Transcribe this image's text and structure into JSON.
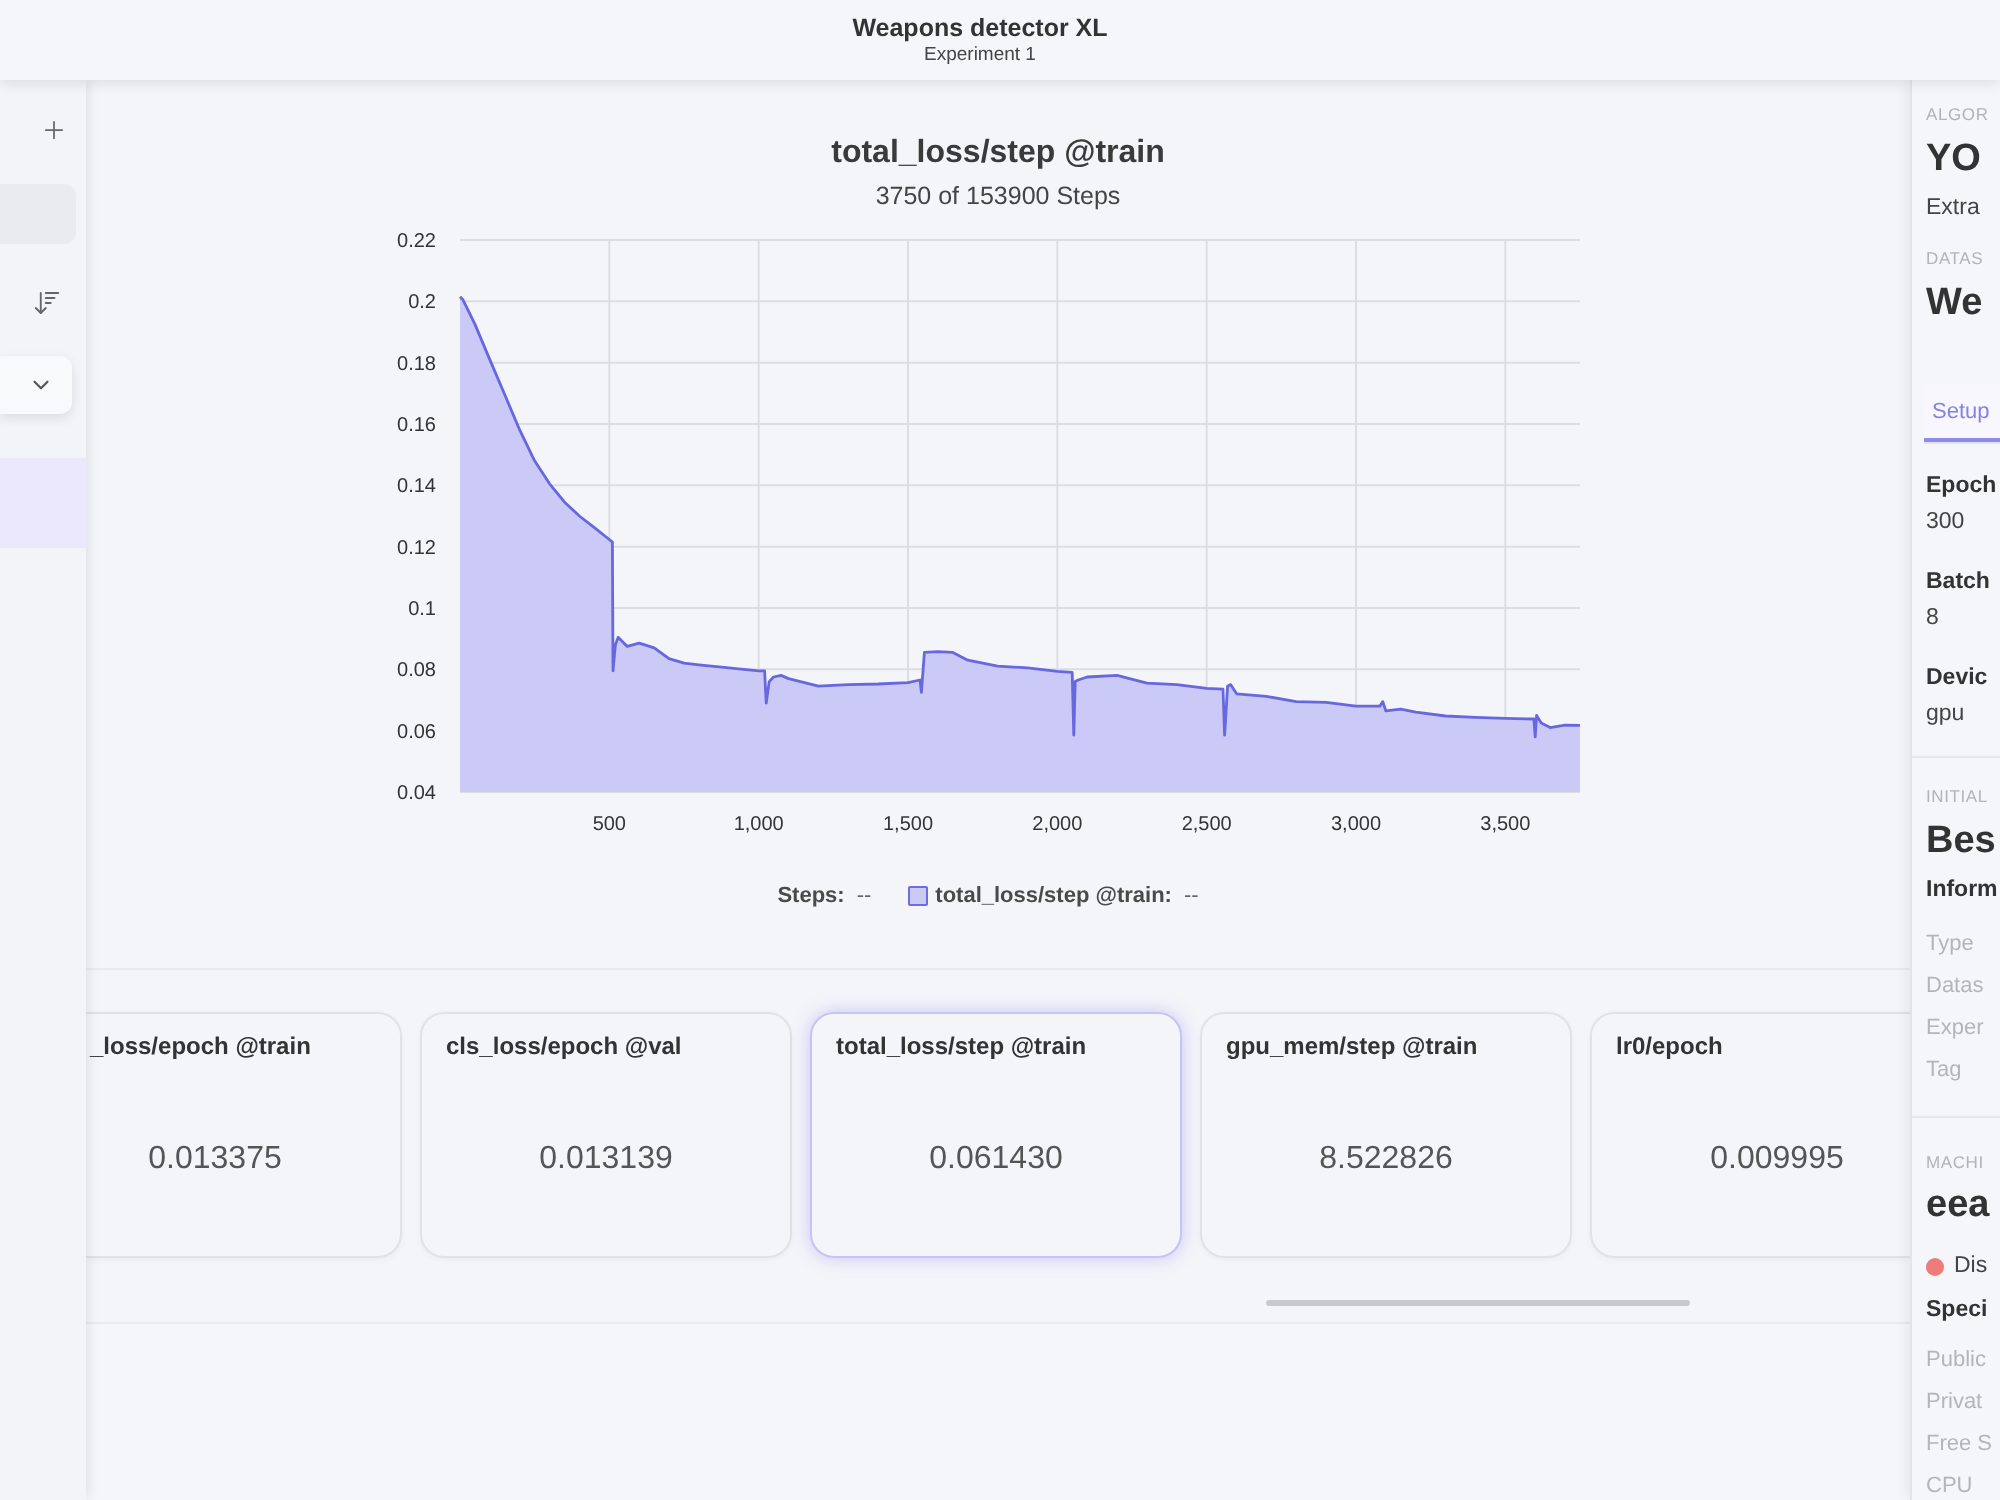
{
  "window": {
    "title": "Weapons detector XL",
    "subtitle": "Experiment 1"
  },
  "sidebar": {
    "items": [
      {
        "selected": true
      }
    ]
  },
  "chart": {
    "subtitle": "3750 of 153900 Steps",
    "chart_data": {
      "type": "area",
      "title": "total_loss/step @train",
      "grid": true,
      "x": [
        0,
        10,
        50,
        100,
        150,
        200,
        250,
        300,
        350,
        400,
        450,
        510,
        512,
        520,
        530,
        560,
        600,
        650,
        700,
        750,
        800,
        900,
        1000,
        1020,
        1025,
        1035,
        1050,
        1075,
        1100,
        1200,
        1300,
        1400,
        1500,
        1540,
        1545,
        1555,
        1600,
        1650,
        1700,
        1800,
        1900,
        2000,
        2050,
        2055,
        2060,
        2070,
        2100,
        2200,
        2300,
        2400,
        2500,
        2555,
        2560,
        2570,
        2580,
        2600,
        2700,
        2800,
        2900,
        3000,
        3080,
        3090,
        3100,
        3150,
        3200,
        3300,
        3400,
        3500,
        3595,
        3600,
        3605,
        3620,
        3650,
        3700,
        3750
      ],
      "values": [
        0.2015,
        0.2005,
        0.1925,
        0.181,
        0.1695,
        0.158,
        0.148,
        0.1405,
        0.1345,
        0.13,
        0.1262,
        0.1215,
        0.0795,
        0.088,
        0.0905,
        0.0875,
        0.0885,
        0.087,
        0.0835,
        0.082,
        0.0815,
        0.0805,
        0.0795,
        0.0795,
        0.069,
        0.076,
        0.0775,
        0.078,
        0.077,
        0.0745,
        0.075,
        0.0752,
        0.0757,
        0.0765,
        0.0725,
        0.0855,
        0.0858,
        0.0855,
        0.083,
        0.081,
        0.0805,
        0.0793,
        0.079,
        0.0585,
        0.076,
        0.0765,
        0.0775,
        0.078,
        0.0755,
        0.075,
        0.0738,
        0.0735,
        0.0585,
        0.0745,
        0.075,
        0.072,
        0.0712,
        0.0695,
        0.0692,
        0.068,
        0.068,
        0.0695,
        0.0665,
        0.067,
        0.066,
        0.0648,
        0.0643,
        0.064,
        0.0638,
        0.058,
        0.065,
        0.0625,
        0.061,
        0.0618,
        0.0617
      ],
      "xlim": [
        0,
        3750
      ],
      "ylim": [
        0.04,
        0.22
      ],
      "xticks": [
        {
          "value": 500,
          "label": "500"
        },
        {
          "value": 1000,
          "label": "1,000"
        },
        {
          "value": 1500,
          "label": "1,500"
        },
        {
          "value": 2000,
          "label": "2,000"
        },
        {
          "value": 2500,
          "label": "2,500"
        },
        {
          "value": 3000,
          "label": "3,000"
        },
        {
          "value": 3500,
          "label": "3,500"
        }
      ],
      "yticks": [
        0.04,
        0.06,
        0.08,
        0.1,
        0.12,
        0.14,
        0.16,
        0.18,
        0.2,
        0.22
      ]
    },
    "legend": [
      {
        "kind": "axis",
        "label": "Steps:",
        "value": "--"
      },
      {
        "kind": "series",
        "label": "total_loss/step @train:",
        "value": "--"
      }
    ]
  },
  "metric_cards": [
    {
      "title": "_loss/epoch @train",
      "value": "0.013375",
      "selected": false
    },
    {
      "title": "cls_loss/epoch @val",
      "value": "0.013139",
      "selected": false
    },
    {
      "title": "total_loss/step @train",
      "value": "0.061430",
      "selected": true
    },
    {
      "title": "gpu_mem/step @train",
      "value": "8.522826",
      "selected": false
    },
    {
      "title": "lr0/epoch",
      "value": "0.009995",
      "selected": false
    }
  ],
  "right_panel": {
    "algorithm": {
      "label": "ALGOR",
      "name": "YO",
      "description": "Extra"
    },
    "dataset": {
      "label": "DATAS",
      "name": "We"
    },
    "tabs": [
      {
        "label": "Setup",
        "selected": true
      }
    ],
    "setup_fields": [
      {
        "label": "Epoch",
        "value": "300"
      },
      {
        "label": "Batch",
        "value": "8"
      },
      {
        "label": "Devic",
        "value": "gpu"
      }
    ],
    "initial": {
      "label": "INITIAL",
      "name": "Bes",
      "info_heading": "Inform",
      "info_rows": [
        "Type",
        "Datas",
        "Exper",
        "Tag"
      ]
    },
    "machine": {
      "label": "MACHI",
      "name": "eea",
      "status": {
        "connected": false,
        "label": "Dis"
      },
      "specs_heading": "Speci",
      "spec_rows": [
        "Public",
        "Privat",
        "Free S",
        "CPU"
      ]
    }
  }
}
